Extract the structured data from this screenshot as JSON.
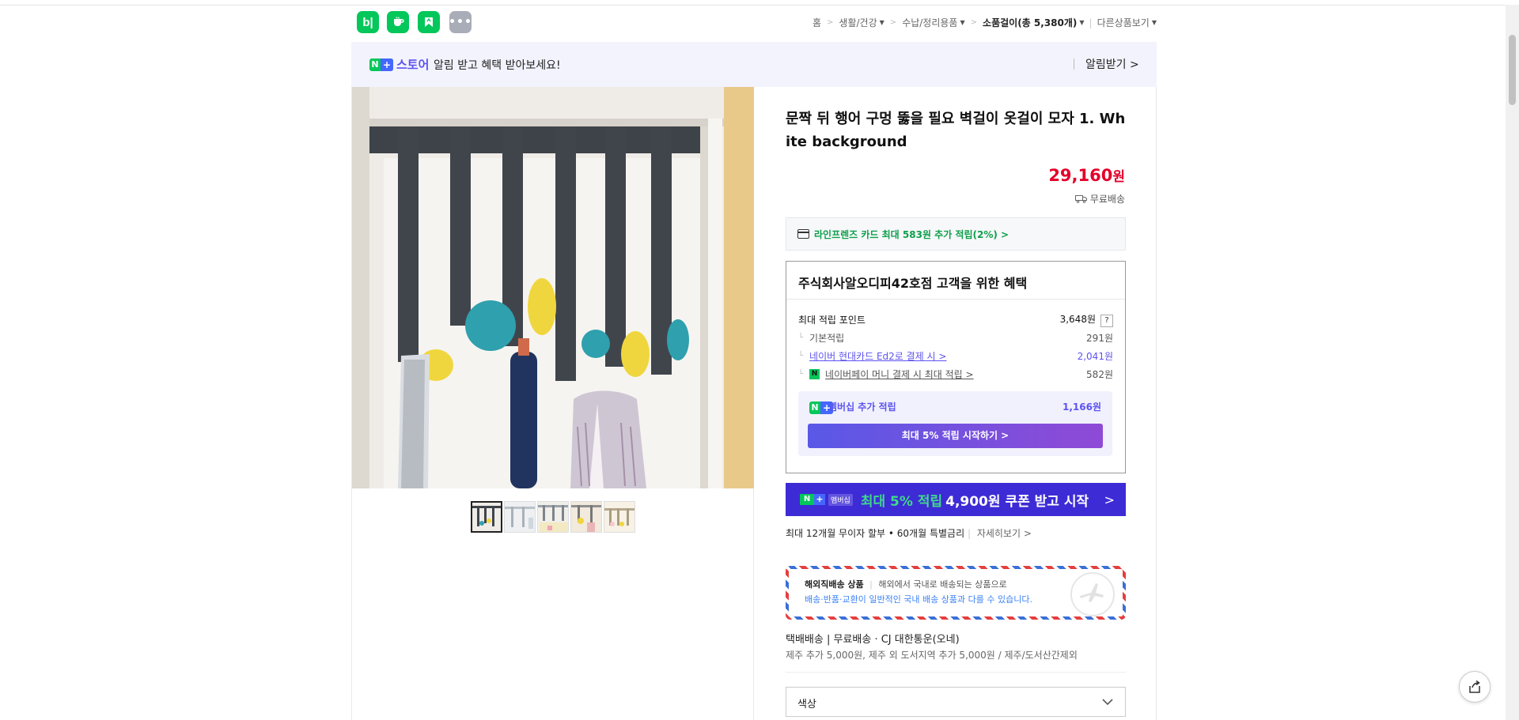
{
  "header": {
    "apps": [
      {
        "name": "blog-icon",
        "glyph": "b|",
        "color": "#03c75a"
      },
      {
        "name": "cafe-icon",
        "glyph": "☕",
        "color": "#03c75a"
      },
      {
        "name": "bookmark-icon",
        "glyph": "",
        "color": "#03c75a"
      },
      {
        "name": "more-apps-icon",
        "glyph": "···",
        "color": "#a8adb8"
      }
    ],
    "breadcrumb": {
      "home": "홈",
      "c1": "생활/건강",
      "c2": "수납/정리용품",
      "c3": "소품걸이(총 5,380개)",
      "other": "다른상품보기"
    }
  },
  "notice": {
    "badge_n": "N",
    "badge_plus": "+",
    "store": "스토어",
    "message": "알림 받고 혜택 받아보세요!",
    "alarm": "알림받기 >"
  },
  "product": {
    "title": "문짝 뒤 행어 구멍 뚫을 필요 벽걸이 옷걸이 모자 1. White background",
    "price": "29,160",
    "price_unit": "원",
    "shipping": "무료배송",
    "card_offer": "라인프렌즈 카드 최대 583원 추가 적립(2%) >"
  },
  "benefit": {
    "heading": "주식회사알오디피42호점 고객을 위한 혜택",
    "max_points_label": "최대 적립 포인트",
    "max_points_value": "3,648원",
    "q": "?",
    "rows": [
      {
        "label": "기본적립",
        "value": "291원"
      },
      {
        "label": "네이버 현대카드 Ed2로 결제 시 >",
        "value": "2,041원"
      },
      {
        "label": "네이버페이 머니 결제 시 최대 적립 >",
        "value": "582원"
      }
    ],
    "membership_label": "멤버십 추가 적립",
    "membership_value": "1,166원",
    "membership_button": "최대 5% 적립 시작하기 >"
  },
  "banner": {
    "tag": "멤버십",
    "highlight": "최대 5% 적립",
    "text": "4,900원 쿠폰 받고 시작",
    "chevron": ">"
  },
  "installment": {
    "text": "최대 12개월 무이자 할부 • 60개월 특별금리",
    "more": "자세히보기 >"
  },
  "overseas": {
    "title": "해외직배송 상품",
    "desc1": "해외에서 국내로 배송되는 상품으로",
    "desc2": "배송·반품·교환이 일반적인 국내 배송 상품과 다를 수 있습니다."
  },
  "delivery": {
    "line1": "택배배송 | 무료배송 · CJ 대한통운(오네)",
    "line2": "제주 추가 5,000원, 제주 외 도서지역 추가 5,000원 / 제주/도서산간제외"
  },
  "option": {
    "label": "색상"
  }
}
